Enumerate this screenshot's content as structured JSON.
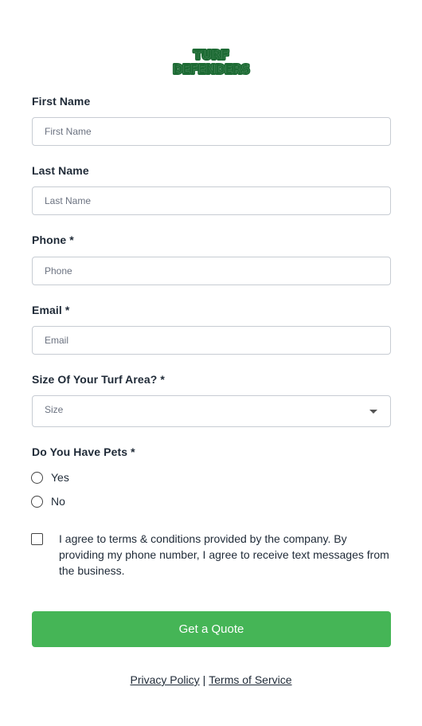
{
  "brand": {
    "logo_line1": "TURF",
    "logo_line2": "DEFENDERS",
    "logo_color": "#1d6b34"
  },
  "fields": {
    "first_name": {
      "label": "First Name",
      "placeholder": "First Name"
    },
    "last_name": {
      "label": "Last Name",
      "placeholder": "Last Name"
    },
    "phone": {
      "label": "Phone *",
      "placeholder": "Phone"
    },
    "email": {
      "label": "Email *",
      "placeholder": "Email"
    },
    "turf_size": {
      "label": "Size Of Your Turf Area? *",
      "value": "Size"
    },
    "pets": {
      "label": "Do You Have Pets *",
      "options": [
        "Yes",
        "No"
      ]
    }
  },
  "consent_text": "I agree to terms & conditions provided by the company. By providing my phone number, I agree to receive text messages from the business.",
  "submit_label": "Get a Quote",
  "footer": {
    "privacy": "Privacy Policy",
    "separator": "|",
    "terms": "Terms of Service"
  },
  "colors": {
    "accent": "#45b556",
    "logo_green": "#1d6b34"
  },
  "icons": {
    "select_caret": "caret-down-icon"
  }
}
